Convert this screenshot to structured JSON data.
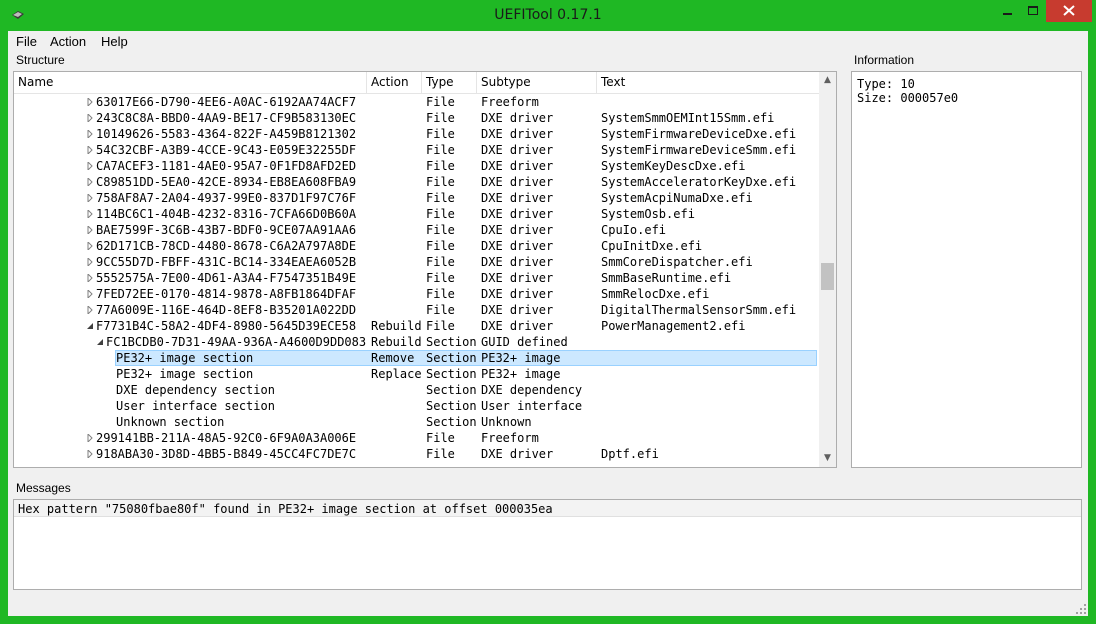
{
  "window": {
    "title": "UEFITool 0.17.1",
    "accent": "#1fb824",
    "close_color": "#c73b2f"
  },
  "menu": [
    "File",
    "Action",
    "Help"
  ],
  "structure": {
    "label": "Structure",
    "columns": [
      "Name",
      "Action",
      "Type",
      "Subtype",
      "Text"
    ],
    "rows": [
      {
        "name": "63017E66-D790-4EE6-A0AC-6192AA74ACF7",
        "action": "",
        "type": "File",
        "subtype": "Freeform",
        "text": "",
        "indent": 1,
        "arrow": "collapsed"
      },
      {
        "name": "243C8C8A-BBD0-4AA9-BE17-CF9B583130EC",
        "action": "",
        "type": "File",
        "subtype": "DXE driver",
        "text": "SystemSmmOEMInt15Smm.efi",
        "indent": 1,
        "arrow": "collapsed"
      },
      {
        "name": "10149626-5583-4364-822F-A459B8121302",
        "action": "",
        "type": "File",
        "subtype": "DXE driver",
        "text": "SystemFirmwareDeviceDxe.efi",
        "indent": 1,
        "arrow": "collapsed"
      },
      {
        "name": "54C32CBF-A3B9-4CCE-9C43-E059E32255DF",
        "action": "",
        "type": "File",
        "subtype": "DXE driver",
        "text": "SystemFirmwareDeviceSmm.efi",
        "indent": 1,
        "arrow": "collapsed"
      },
      {
        "name": "CA7ACEF3-1181-4AE0-95A7-0F1FD8AFD2ED",
        "action": "",
        "type": "File",
        "subtype": "DXE driver",
        "text": "SystemKeyDescDxe.efi",
        "indent": 1,
        "arrow": "collapsed"
      },
      {
        "name": "C89851DD-5EA0-42CE-8934-EB8EA608FBA9",
        "action": "",
        "type": "File",
        "subtype": "DXE driver",
        "text": "SystemAcceleratorKeyDxe.efi",
        "indent": 1,
        "arrow": "collapsed"
      },
      {
        "name": "758AF8A7-2A04-4937-99E0-837D1F97C76F",
        "action": "",
        "type": "File",
        "subtype": "DXE driver",
        "text": "SystemAcpiNumaDxe.efi",
        "indent": 1,
        "arrow": "collapsed"
      },
      {
        "name": "114BC6C1-404B-4232-8316-7CFA66D0B60A",
        "action": "",
        "type": "File",
        "subtype": "DXE driver",
        "text": "SystemOsb.efi",
        "indent": 1,
        "arrow": "collapsed"
      },
      {
        "name": "BAE7599F-3C6B-43B7-BDF0-9CE07AA91AA6",
        "action": "",
        "type": "File",
        "subtype": "DXE driver",
        "text": "CpuIo.efi",
        "indent": 1,
        "arrow": "collapsed"
      },
      {
        "name": "62D171CB-78CD-4480-8678-C6A2A797A8DE",
        "action": "",
        "type": "File",
        "subtype": "DXE driver",
        "text": "CpuInitDxe.efi",
        "indent": 1,
        "arrow": "collapsed"
      },
      {
        "name": "9CC55D7D-FBFF-431C-BC14-334EAEA6052B",
        "action": "",
        "type": "File",
        "subtype": "DXE driver",
        "text": "SmmCoreDispatcher.efi",
        "indent": 1,
        "arrow": "collapsed"
      },
      {
        "name": "5552575A-7E00-4D61-A3A4-F7547351B49E",
        "action": "",
        "type": "File",
        "subtype": "DXE driver",
        "text": "SmmBaseRuntime.efi",
        "indent": 1,
        "arrow": "collapsed"
      },
      {
        "name": "7FED72EE-0170-4814-9878-A8FB1864DFAF",
        "action": "",
        "type": "File",
        "subtype": "DXE driver",
        "text": "SmmRelocDxe.efi",
        "indent": 1,
        "arrow": "collapsed"
      },
      {
        "name": "77A6009E-116E-464D-8EF8-B35201A022DD",
        "action": "",
        "type": "File",
        "subtype": "DXE driver",
        "text": "DigitalThermalSensorSmm.efi",
        "indent": 1,
        "arrow": "collapsed"
      },
      {
        "name": "F7731B4C-58A2-4DF4-8980-5645D39ECE58",
        "action": "Rebuild",
        "type": "File",
        "subtype": "DXE driver",
        "text": "PowerManagement2.efi",
        "indent": 1,
        "arrow": "expanded"
      },
      {
        "name": "FC1BCDB0-7D31-49AA-936A-A4600D9DD083",
        "action": "Rebuild",
        "type": "Section",
        "subtype": "GUID defined",
        "text": "",
        "indent": 2,
        "arrow": "expanded"
      },
      {
        "name": "PE32+ image section",
        "action": "Remove",
        "type": "Section",
        "subtype": "PE32+ image",
        "text": "",
        "indent": 3,
        "arrow": "none",
        "selected": true
      },
      {
        "name": "PE32+ image section",
        "action": "Replace",
        "type": "Section",
        "subtype": "PE32+ image",
        "text": "",
        "indent": 3,
        "arrow": "none"
      },
      {
        "name": "DXE dependency section",
        "action": "",
        "type": "Section",
        "subtype": "DXE dependency",
        "text": "",
        "indent": 3,
        "arrow": "none"
      },
      {
        "name": "User interface section",
        "action": "",
        "type": "Section",
        "subtype": "User interface",
        "text": "",
        "indent": 3,
        "arrow": "none"
      },
      {
        "name": "Unknown section",
        "action": "",
        "type": "Section",
        "subtype": "Unknown",
        "text": "",
        "indent": 3,
        "arrow": "none"
      },
      {
        "name": "299141BB-211A-48A5-92C0-6F9A0A3A006E",
        "action": "",
        "type": "File",
        "subtype": "Freeform",
        "text": "",
        "indent": 1,
        "arrow": "collapsed"
      },
      {
        "name": "918ABA30-3D8D-4BB5-B849-45CC4FC7DE7C",
        "action": "",
        "type": "File",
        "subtype": "DXE driver",
        "text": "Dptf.efi",
        "indent": 1,
        "arrow": "collapsed"
      }
    ]
  },
  "information": {
    "label": "Information",
    "text": "Type: 10\nSize: 000057e0"
  },
  "messages": {
    "label": "Messages",
    "items": [
      "Hex pattern \"75080fbae80f\" found in PE32+ image section at offset 000035ea"
    ]
  }
}
